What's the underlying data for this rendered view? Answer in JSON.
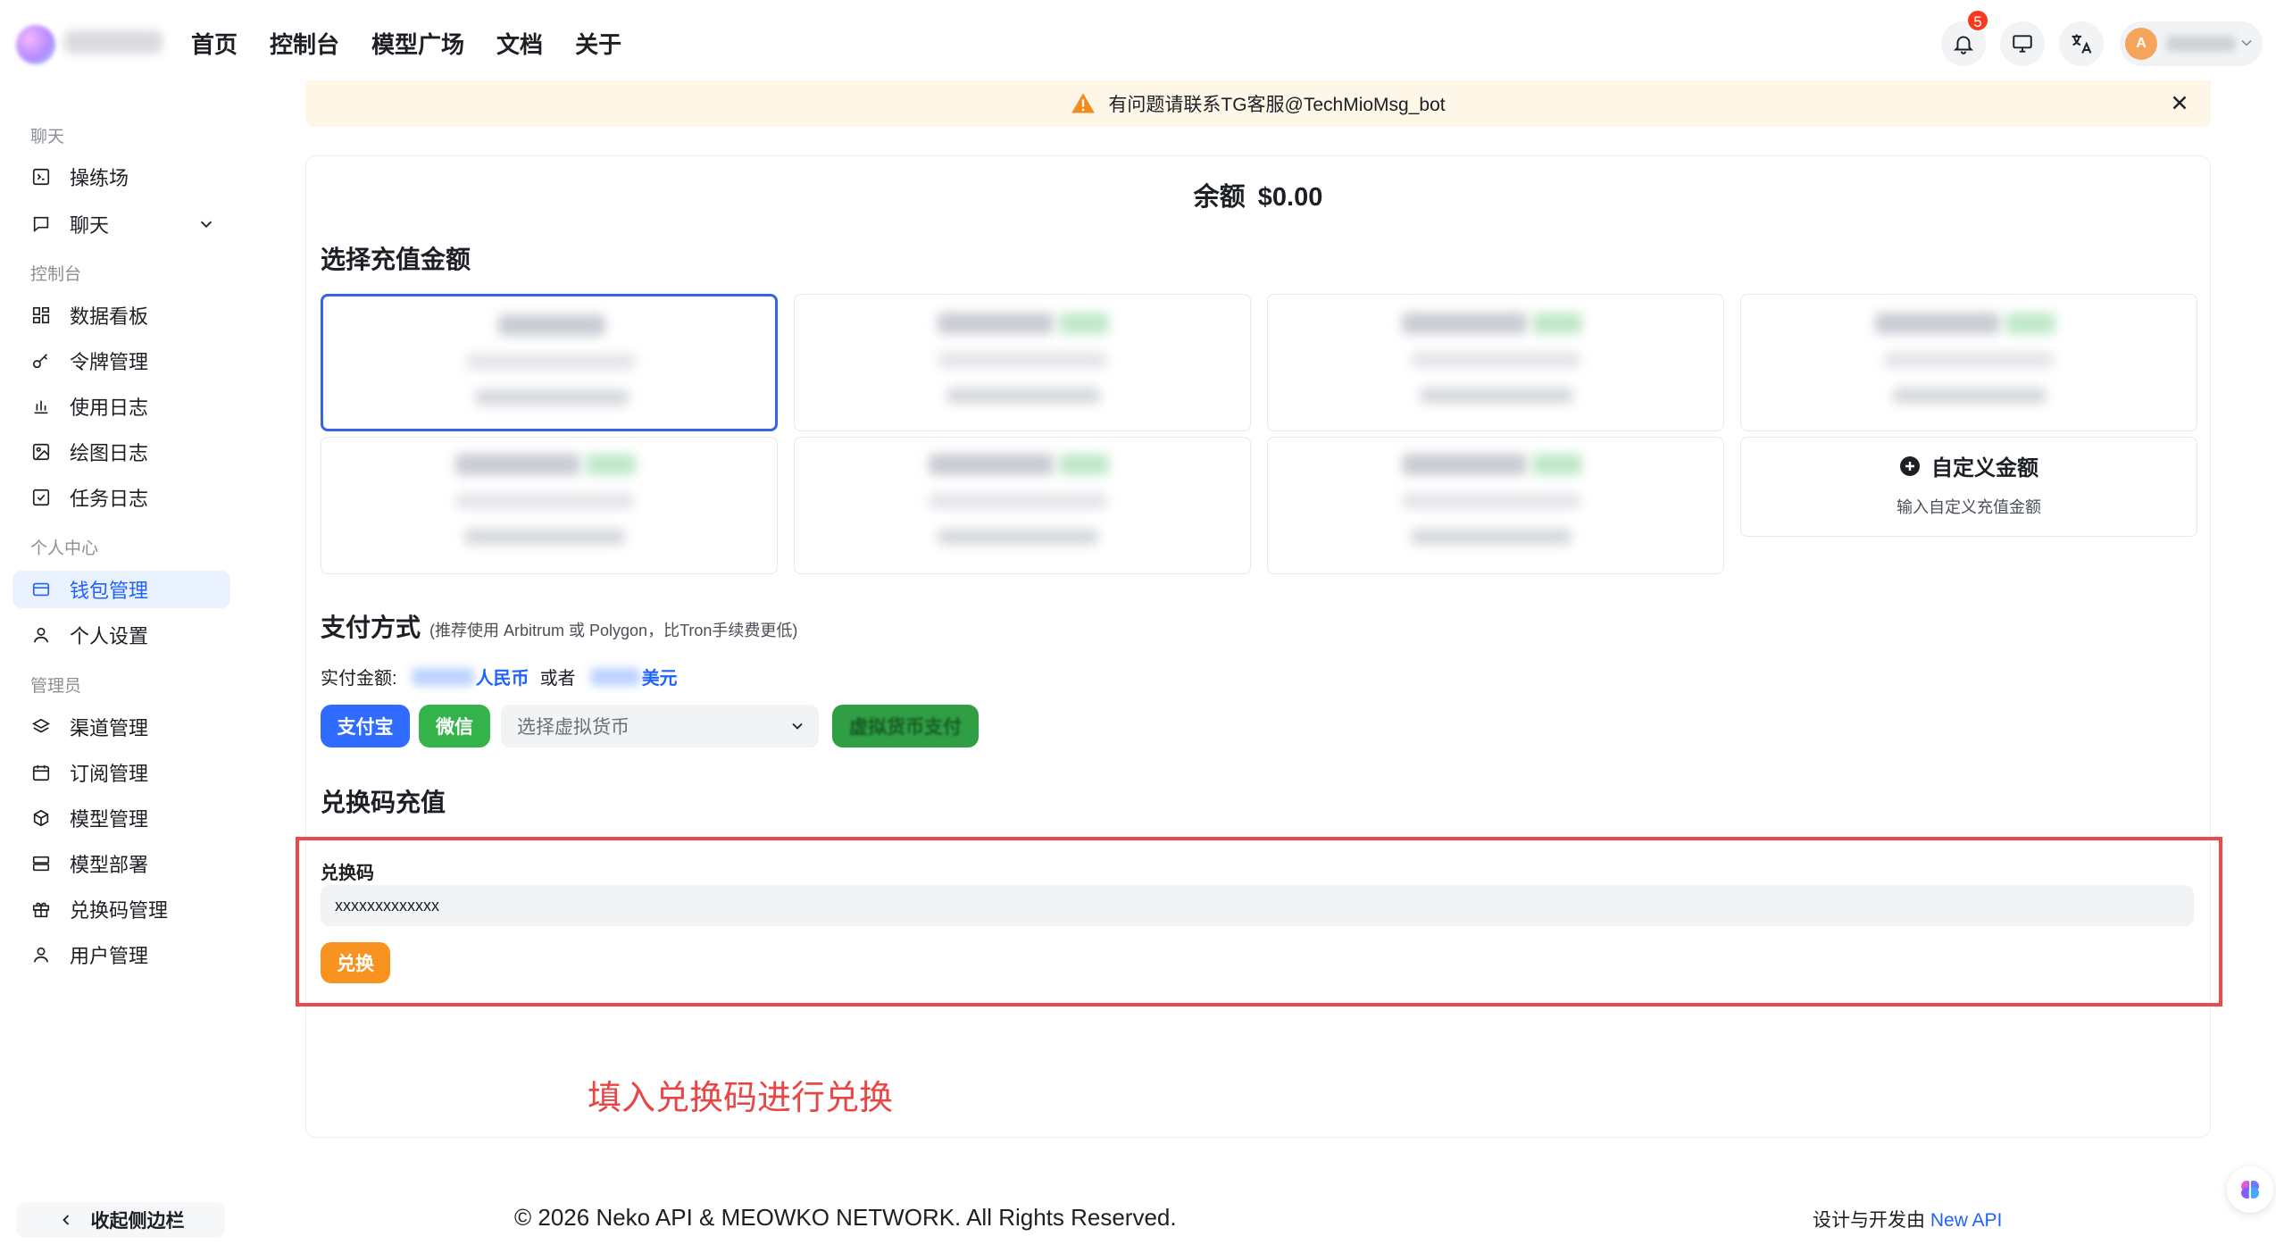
{
  "header": {
    "nav": [
      "首页",
      "控制台",
      "模型广场",
      "文档",
      "关于"
    ],
    "notification_count": "5",
    "user_initial": "A"
  },
  "sidebar": {
    "groups": {
      "chat": "聊天",
      "console": "控制台",
      "personal": "个人中心",
      "admin": "管理员"
    },
    "items": [
      {
        "label": "操练场",
        "icon": "playground-icon"
      },
      {
        "label": "聊天",
        "icon": "chat-icon"
      },
      {
        "label": "数据看板",
        "icon": "dashboard-icon"
      },
      {
        "label": "令牌管理",
        "icon": "key-icon"
      },
      {
        "label": "使用日志",
        "icon": "bar-chart-icon"
      },
      {
        "label": "绘图日志",
        "icon": "image-icon"
      },
      {
        "label": "任务日志",
        "icon": "task-check-icon"
      },
      {
        "label": "钱包管理",
        "icon": "wallet-icon",
        "active": true
      },
      {
        "label": "个人设置",
        "icon": "user-icon"
      },
      {
        "label": "渠道管理",
        "icon": "layers-icon"
      },
      {
        "label": "订阅管理",
        "icon": "calendar-icon"
      },
      {
        "label": "模型管理",
        "icon": "cube-icon"
      },
      {
        "label": "模型部署",
        "icon": "server-icon"
      },
      {
        "label": "兑换码管理",
        "icon": "gift-icon"
      },
      {
        "label": "用户管理",
        "icon": "user-icon"
      }
    ],
    "collapse_label": "收起侧边栏"
  },
  "notice": {
    "text": "有问题请联系TG客服@TechMioMsg_bot"
  },
  "wallet": {
    "balance_label": "余额",
    "balance_value": "$0.00",
    "select_amount_title": "选择充值金额",
    "custom_amount": {
      "title": "自定义金额",
      "subtitle": "输入自定义充值金额"
    },
    "payment_title": "支付方式",
    "payment_hint": "(推荐使用 Arbitrum 或 Polygon，比Tron手续费更低)",
    "actual_amount_label": "实付金额:",
    "currency_cny": "人民币",
    "or_label": "或者",
    "currency_usd": "美元",
    "alipay_label": "支付宝",
    "wechat_label": "微信",
    "crypto_select_placeholder": "选择虚拟货币",
    "crypto_pay_label": "虚拟货币支付",
    "redeem_title": "兑换码充值",
    "redeem_field_label": "兑换码",
    "redeem_placeholder": "xxxxxxxxxxxxx",
    "redeem_button": "兑换"
  },
  "annotation": "填入兑换码进行兑换",
  "footer": {
    "copyright": "© 2026 Neko API & MEOWKO NETWORK. All Rights Reserved.",
    "designed_by": "设计与开发由",
    "designed_link": "New API"
  },
  "colors": {
    "primary": "#1e63ff",
    "alipay": "#2f6bff",
    "wechat": "#34b34a",
    "redeem": "#f7931e",
    "highlight_box": "#ec4a4a",
    "notice_bg": "#fef7e8"
  }
}
